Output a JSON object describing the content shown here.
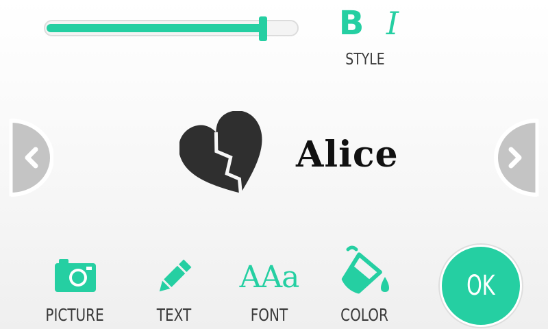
{
  "slider": {
    "value_fraction": 0.86
  },
  "style": {
    "bold_label": "B",
    "italic_label": "I",
    "label": "STYLE"
  },
  "navigation": {
    "prev_icon": "chevron-left-icon",
    "next_icon": "chevron-right-icon"
  },
  "preview": {
    "icon": "broken-heart-icon",
    "name": "Alice"
  },
  "toolbar": {
    "picture_label": "PICTURE",
    "picture_icon": "camera-icon",
    "text_label": "TEXT",
    "text_icon": "pencil-icon",
    "font_label": "FONT",
    "font_glyphs": "AAa",
    "color_label": "COLOR",
    "color_icon": "paint-bucket-icon",
    "ok_label": "OK"
  },
  "colors": {
    "accent": "#25cfa2",
    "text": "#3a3a3a",
    "arrow_gray": "#c4c4c4",
    "heart": "#2f2f2f"
  }
}
